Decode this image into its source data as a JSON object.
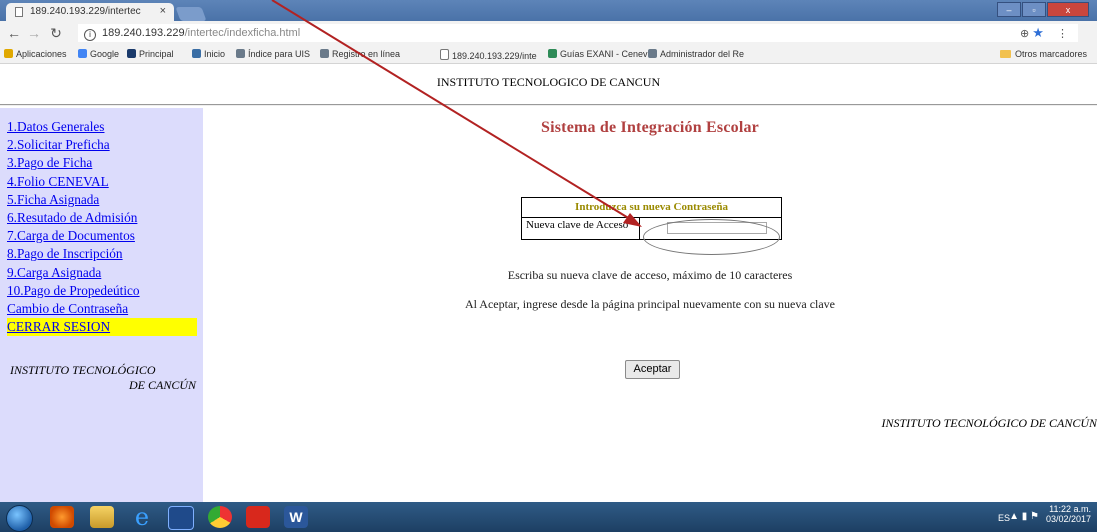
{
  "browser": {
    "tab_title": "189.240.193.229/intertec",
    "tab_close": "×",
    "url_host": "189.240.193.229",
    "url_path": "/intertec/indexficha.html",
    "window_controls": [
      "–",
      "▫",
      "x"
    ],
    "zoom_icon": "⊕",
    "menu_icon": "⋮",
    "bookmarks": [
      {
        "label": "Aplicaciones",
        "icon": "apps-icon",
        "color": "#e0a800"
      },
      {
        "label": "Google",
        "icon": "google-icon",
        "color": "#4285f4"
      },
      {
        "label": "Principal",
        "icon": "principal-icon",
        "color": "#1a3a6b"
      },
      {
        "label": "Inicio",
        "icon": "inicio-icon",
        "color": "#3a6ea5"
      },
      {
        "label": "Índice para UIS",
        "icon": "uis-icon",
        "color": "#6a7a8a"
      },
      {
        "label": "Registro en línea",
        "icon": "registro-icon",
        "color": "#6a7a8a"
      },
      {
        "label": "189.240.193.229/inte",
        "icon": "page-icon",
        "color": "#ffffff"
      },
      {
        "label": "Guías EXANI - Cenev",
        "icon": "exani-icon",
        "color": "#2e8b57"
      },
      {
        "label": "Administrador del Re",
        "icon": "admin-icon",
        "color": "#6a7a8a"
      }
    ],
    "other_bookmarks": "Otros marcadores"
  },
  "page": {
    "header_title": "INSTITUTO TECNOLOGICO DE CANCUN",
    "main_title": "Sistema de Integración Escolar",
    "menu": [
      "1.Datos Generales",
      "2.Solicitar Preficha",
      "3.Pago de Ficha",
      "4.Folio CENEVAL",
      "5.Ficha Asignada",
      "6.Resutado de Admisión",
      "7.Carga de Documentos",
      "8.Pago de Inscripción",
      "9.Carga Asignada",
      "10.Pago de Propedeútico",
      "Cambio de Contraseña",
      "CERRAR SESION"
    ],
    "sidebar_institute_line1": "INSTITUTO TECNOLÓGICO",
    "sidebar_institute_line2": "DE CANCÚN",
    "form_header": "Introduzca su nueva Contraseña",
    "form_label": "Nueva clave de Acceso",
    "password_value": "",
    "note_1": "Escriba su nueva clave de acceso, máximo de 10 caracteres",
    "note_2": "Al Aceptar, ingrese desde la página principal nuevamente con su nueva clave",
    "accept_button": "Aceptar",
    "footer_institute": "INSTITUTO TECNOLÓGICO DE CANCÚN"
  },
  "taskbar": {
    "language": "ES",
    "time": "11:22 a.m.",
    "date": "03/02/2017",
    "apps": [
      "firefox-icon",
      "explorer-icon",
      "ie-icon",
      "media-icon",
      "chrome-icon",
      "pdf-icon",
      "word-icon"
    ]
  },
  "colors": {
    "sidebar_bg": "#dcdcfc",
    "title_red": "#b04040",
    "form_header_olive": "#9a8a00",
    "highlight_yellow": "#ffff00",
    "annotation_arrow": "#b22222"
  }
}
